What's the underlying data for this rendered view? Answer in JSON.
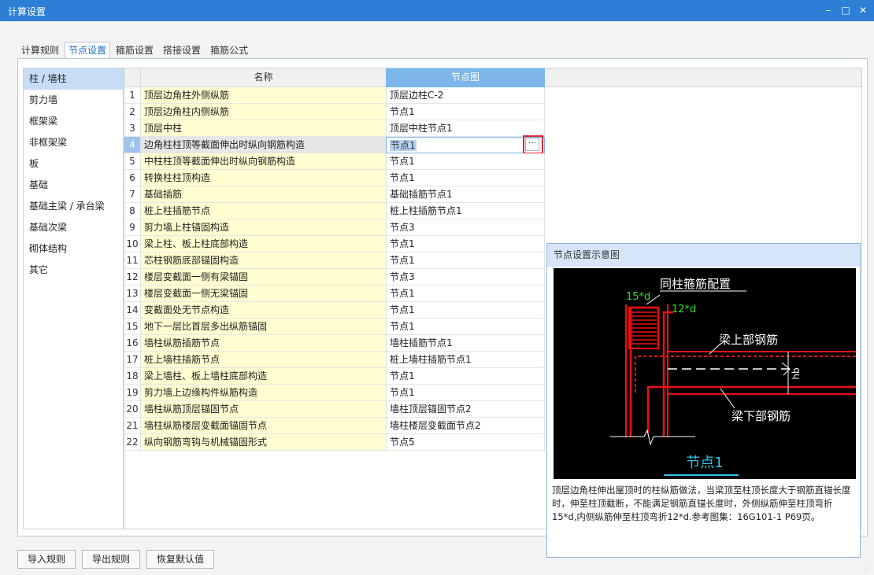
{
  "window": {
    "title": "计算设置",
    "minimize_symbol": "–",
    "maximize_symbol": "□",
    "close_symbol": "✕"
  },
  "tabs": [
    {
      "label": "计算规则",
      "active": false
    },
    {
      "label": "节点设置",
      "active": true
    },
    {
      "label": "箍筋设置",
      "active": false
    },
    {
      "label": "搭接设置",
      "active": false
    },
    {
      "label": "箍筋公式",
      "active": false
    }
  ],
  "categories": [
    {
      "label": "柱 / 墙柱",
      "selected": true
    },
    {
      "label": "剪力墙",
      "selected": false
    },
    {
      "label": "框架梁",
      "selected": false
    },
    {
      "label": "非框架梁",
      "selected": false
    },
    {
      "label": "板",
      "selected": false
    },
    {
      "label": "基础",
      "selected": false
    },
    {
      "label": "基础主梁 / 承台梁",
      "selected": false
    },
    {
      "label": "基础次梁",
      "selected": false
    },
    {
      "label": "砌体结构",
      "selected": false
    },
    {
      "label": "其它",
      "selected": false
    }
  ],
  "grid": {
    "headers": {
      "name": "名称",
      "node": "节点图"
    },
    "selected_row": 4,
    "ellipsis_label": "···",
    "rows": [
      {
        "num": "1",
        "name": "顶层边角柱外侧纵筋",
        "node": "顶层边柱C-2"
      },
      {
        "num": "2",
        "name": "顶层边角柱内侧纵筋",
        "node": "节点1"
      },
      {
        "num": "3",
        "name": "顶层中柱",
        "node": "顶层中柱节点1"
      },
      {
        "num": "4",
        "name": "边角柱柱顶等截面伸出时纵向钢筋构造",
        "node": "节点1"
      },
      {
        "num": "5",
        "name": "中柱柱顶等截面伸出时纵向钢筋构造",
        "node": "节点1"
      },
      {
        "num": "6",
        "name": "转换柱柱顶构造",
        "node": "节点1"
      },
      {
        "num": "7",
        "name": "基础插筋",
        "node": "基础插筋节点1"
      },
      {
        "num": "8",
        "name": "桩上柱插筋节点",
        "node": "桩上柱插筋节点1"
      },
      {
        "num": "9",
        "name": "剪力墙上柱锚固构造",
        "node": "节点3"
      },
      {
        "num": "10",
        "name": "梁上柱、板上柱底部构造",
        "node": "节点1"
      },
      {
        "num": "11",
        "name": "芯柱钢筋底部锚固构造",
        "node": "节点1"
      },
      {
        "num": "12",
        "name": "楼层变截面一侧有梁锚固",
        "node": "节点3"
      },
      {
        "num": "13",
        "name": "楼层变截面一侧无梁锚固",
        "node": "节点1"
      },
      {
        "num": "14",
        "name": "变截面处无节点构造",
        "node": "节点1"
      },
      {
        "num": "15",
        "name": "地下一层比首层多出纵筋锚固",
        "node": "节点1"
      },
      {
        "num": "16",
        "name": "墙柱纵筋插筋节点",
        "node": "墙柱插筋节点1"
      },
      {
        "num": "17",
        "name": "桩上墙柱插筋节点",
        "node": "桩上墙柱插筋节点1"
      },
      {
        "num": "18",
        "name": "梁上墙柱、板上墙柱底部构造",
        "node": "节点1"
      },
      {
        "num": "19",
        "name": "剪力墙上边缘构件纵筋构造",
        "node": "节点1"
      },
      {
        "num": "20",
        "name": "墙柱纵筋顶层锚固节点",
        "node": "墙柱顶层锚固节点2"
      },
      {
        "num": "21",
        "name": "墙柱纵筋楼层变截面锚固节点",
        "node": "墙柱楼层变截面节点2"
      },
      {
        "num": "22",
        "name": "纵向钢筋弯钩与机械锚固形式",
        "node": "节点5"
      }
    ]
  },
  "preview": {
    "title": "节点设置示意图",
    "diagram": {
      "label_stirrup": "同柱箍筋配置",
      "label_15d": "15*d",
      "label_12d": "12*d",
      "label_top_rebar": "梁上部钢筋",
      "label_bottom_rebar": "梁下部钢筋",
      "label_hb": "hb",
      "node_name": "节点1"
    },
    "description": "顶层边角柱伸出屋顶时的柱纵筋做法，当梁顶至柱顶长度大于钢筋直锚长度时，伸至柱顶截断，不能满足钢筋直锚长度时，外侧纵筋伸至柱顶弯折15*d,内侧纵筋伸至柱顶弯折12*d.参考图集：16G101-1 P69页。"
  },
  "buttons": {
    "import": "导入规则",
    "export": "导出规则",
    "restore": "恢复默认值"
  },
  "colors": {
    "titlebar": "#2d7fd6",
    "header_active": "#7cb6ea",
    "name_cell_bg": "#fffed0",
    "highlight_red": "#e3262c"
  }
}
